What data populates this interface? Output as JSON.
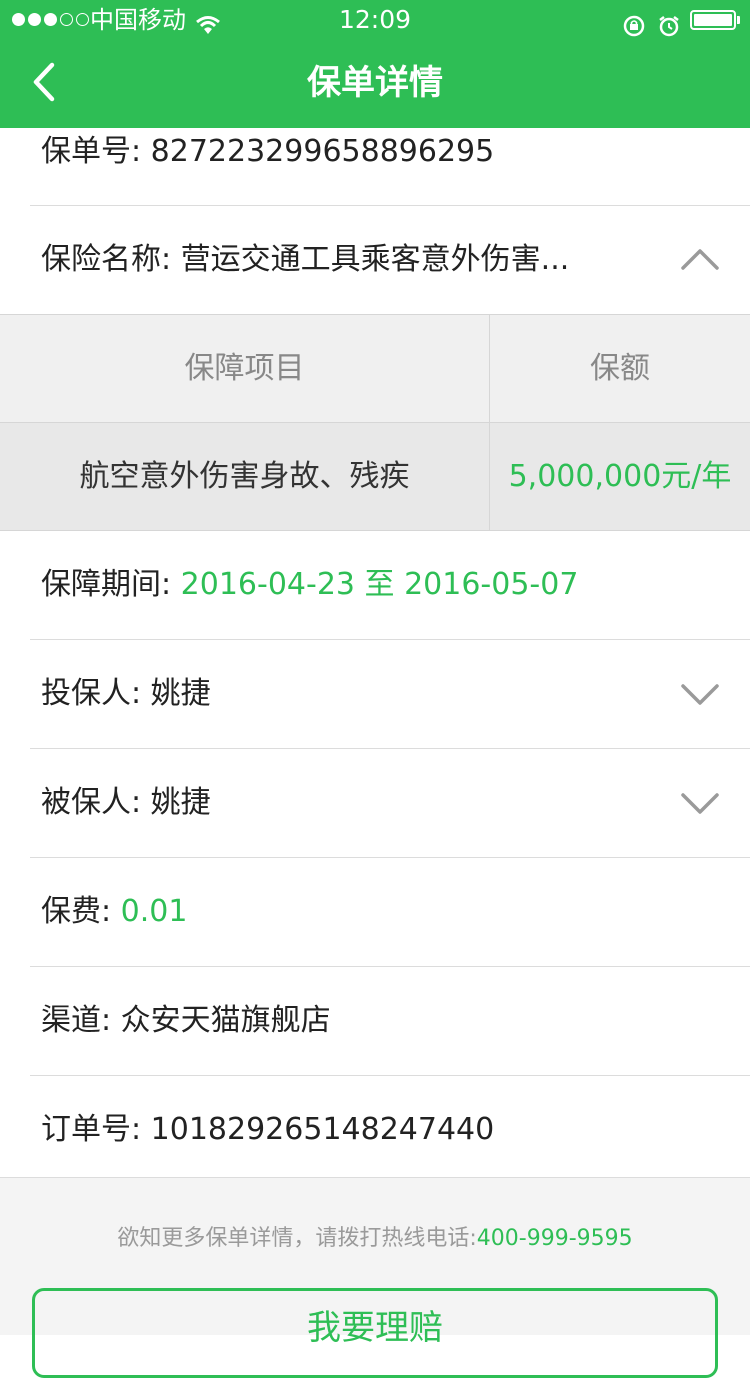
{
  "status_bar": {
    "carrier": "中国移动",
    "time": "12:09"
  },
  "header": {
    "title": "保单详情"
  },
  "policy": {
    "policy_no_label": "保单号:",
    "policy_no": "827223299658896295",
    "name_label": "保险名称:",
    "name": "营运交通工具乘客意外伤害...",
    "coverage_table": {
      "headers": [
        "保障项目",
        "保额"
      ],
      "rows": [
        {
          "item": "航空意外伤害身故、残疾",
          "amount": "5,000,000元/年"
        }
      ]
    },
    "period_label": "保障期间:",
    "period": "2016-04-23 至 2016-05-07",
    "applicant_label": "投保人:",
    "applicant": "姚捷",
    "insured_label": "被保人:",
    "insured": "姚捷",
    "premium_label": "保费:",
    "premium": "0.01",
    "channel_label": "渠道:",
    "channel": "众安天猫旗舰店",
    "order_no_label": "订单号:",
    "order_no": "101829265148247440"
  },
  "footer": {
    "hotline_text": "欲知更多保单详情，请拨打热线电话:",
    "hotline_number": "400-999-9595",
    "claim_button": "我要理赔"
  },
  "colors": {
    "brand_green": "#2ebe55",
    "header_text": "#ffffff",
    "divider": "#dcdcdc"
  },
  "icons": {
    "back": "back-arrow-icon",
    "expand_up": "chevron-up-icon",
    "expand_down": "chevron-down-icon"
  }
}
